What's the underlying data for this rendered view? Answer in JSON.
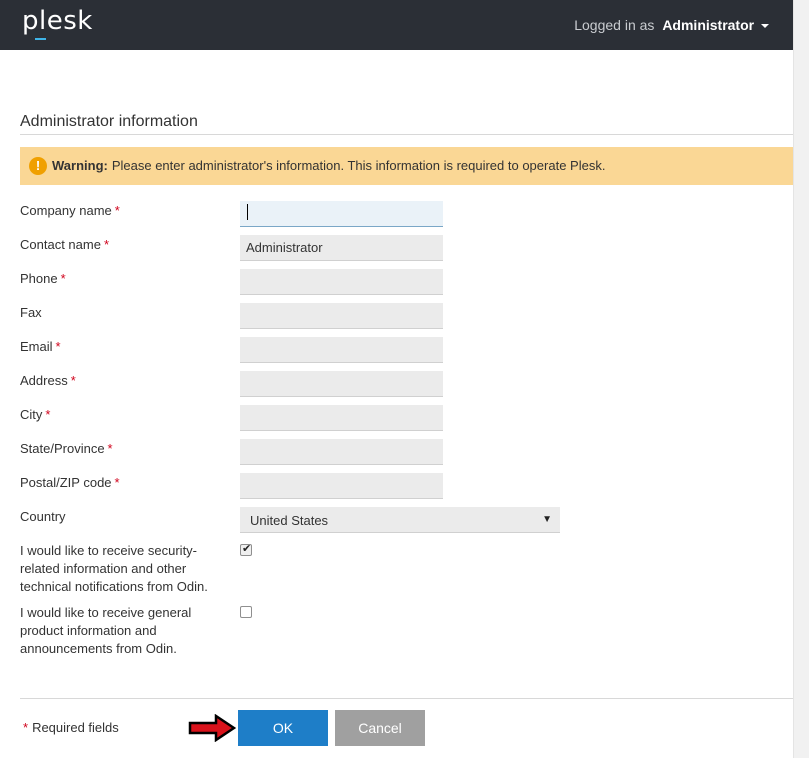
{
  "header": {
    "logo_text": "plesk",
    "logged_in_prefix": "Logged in as",
    "user": "Administrator"
  },
  "section": {
    "title": "Administrator information"
  },
  "warning": {
    "icon": "exclamation-icon",
    "bold": "Warning:",
    "text": "Please enter administrator's information. This information is required to operate Plesk."
  },
  "form": {
    "required_mark": "*",
    "fields": [
      {
        "label": "Company name",
        "required": true,
        "value": ""
      },
      {
        "label": "Contact name",
        "required": true,
        "value": "Administrator"
      },
      {
        "label": "Phone",
        "required": true,
        "value": ""
      },
      {
        "label": "Fax",
        "required": false,
        "value": ""
      },
      {
        "label": "Email",
        "required": true,
        "value": ""
      },
      {
        "label": "Address",
        "required": true,
        "value": ""
      },
      {
        "label": "City",
        "required": true,
        "value": ""
      },
      {
        "label": "State/Province",
        "required": true,
        "value": ""
      },
      {
        "label": "Postal/ZIP code",
        "required": true,
        "value": ""
      }
    ],
    "country": {
      "label": "Country",
      "value": "United States"
    },
    "security_notifications": {
      "lines": [
        "I would like to receive security-",
        "related information and other",
        "technical notifications from Odin."
      ],
      "checked": true
    },
    "general_notifications": {
      "lines": [
        "I would like to receive general",
        "product information and",
        "announcements from Odin."
      ],
      "checked": false
    }
  },
  "footer": {
    "required_star": "*",
    "required_text": "Required fields",
    "ok_label": "OK",
    "cancel_label": "Cancel"
  },
  "colors": {
    "topbar": "#2b2f36",
    "warning_bg": "#fad795",
    "primary_button": "#1e7ec8",
    "secondary_button": "#a0a0a0",
    "required": "#d0021b"
  }
}
